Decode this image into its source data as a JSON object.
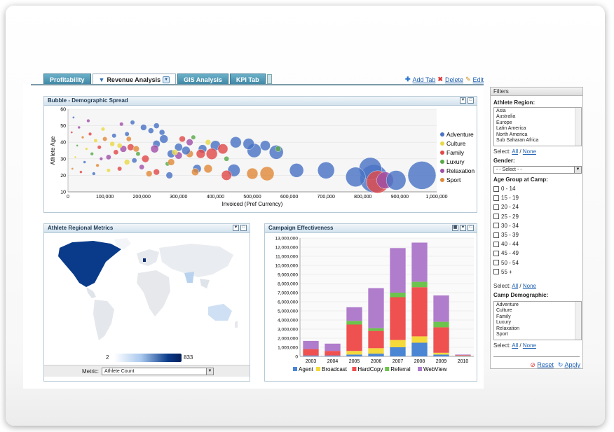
{
  "tabs": [
    {
      "label": "Profitability",
      "active": false
    },
    {
      "label": "Revenue Analysis",
      "active": true
    },
    {
      "label": "GIS Analysis",
      "active": false
    },
    {
      "label": "KPI Tab",
      "active": false
    }
  ],
  "tab_actions": {
    "add": "Add Tab",
    "delete": "Delete",
    "edit": "Edit"
  },
  "bubble_panel": {
    "title": "Bubble - Demographic Spread"
  },
  "map_panel": {
    "title": "Athlete Regional Metrics",
    "legend_min": "2",
    "legend_max": "833",
    "metric_label": "Metric:",
    "metric_value": "Athlete Count"
  },
  "campaign_panel": {
    "title": "Campaign Effectiveness"
  },
  "filters": {
    "title": "Filters",
    "region_label": "Athlete Region:",
    "regions": [
      "Asia",
      "Australia",
      "Europe",
      "Latin America",
      "North America",
      "Sub Saharan Africa"
    ],
    "select_label": "Select:",
    "all": "All",
    "none": "None",
    "slash": "/",
    "gender_label": "Gender:",
    "gender_value": "- - Select - -",
    "age_label": "Age Group at Camp:",
    "age_groups": [
      "0 - 14",
      "15 - 19",
      "20 - 24",
      "25 - 29",
      "30 - 34",
      "35 - 39",
      "40 - 44",
      "45 - 49",
      "50 - 54",
      "55 +"
    ],
    "camp_label": "Camp Demographic:",
    "camps": [
      "Adventure",
      "Culture",
      "Family",
      "Luxury",
      "Relaxation",
      "Sport"
    ],
    "reset": "Reset",
    "apply": "Apply"
  },
  "colors": {
    "adventure": "#4a74c4",
    "culture": "#e8d84a",
    "family": "#e04a4a",
    "luxury": "#5aa84a",
    "relaxation": "#a050a8",
    "sport": "#e08a3a"
  },
  "chart_data": [
    {
      "type": "scatter",
      "title": "Bubble - Demographic Spread",
      "xlabel": "Invoiced (Pref Currency)",
      "ylabel": "Athlete Age",
      "xlim": [
        0,
        1000000
      ],
      "ylim": [
        10,
        60
      ],
      "x_ticks": [
        "0",
        "100,000",
        "200,000",
        "300,000",
        "400,000",
        "500,000",
        "600,000",
        "700,000",
        "800,000",
        "900,000",
        "1,000,000"
      ],
      "y_ticks": [
        "10",
        "20",
        "30",
        "40",
        "50",
        "60"
      ],
      "legend": [
        "Adventure",
        "Culture",
        "Family",
        "Luxury",
        "Relaxation",
        "Sport"
      ],
      "legend_position": "right",
      "points": [
        {
          "s": "Adventure",
          "x": 960000,
          "y": 20,
          "r": 5
        },
        {
          "s": "Adventure",
          "x": 830000,
          "y": 18,
          "r": 5
        },
        {
          "s": "Adventure",
          "x": 820000,
          "y": 24,
          "r": 4
        },
        {
          "s": "Family",
          "x": 840000,
          "y": 16,
          "r": 4
        },
        {
          "s": "Relaxation",
          "x": 860000,
          "y": 17,
          "r": 3
        },
        {
          "s": "Adventure",
          "x": 780000,
          "y": 19,
          "r": 3.5
        },
        {
          "s": "Adventure",
          "x": 890000,
          "y": 17,
          "r": 3.5
        },
        {
          "s": "Adventure",
          "x": 700000,
          "y": 23,
          "r": 3
        },
        {
          "s": "Adventure",
          "x": 620000,
          "y": 23,
          "r": 2.5
        },
        {
          "s": "Adventure",
          "x": 565000,
          "y": 34,
          "r": 2.5
        },
        {
          "s": "Adventure",
          "x": 505000,
          "y": 35,
          "r": 2.5
        },
        {
          "s": "Sport",
          "x": 540000,
          "y": 21,
          "r": 2.5
        },
        {
          "s": "Sport",
          "x": 500000,
          "y": 21,
          "r": 2
        },
        {
          "s": "Adventure",
          "x": 450000,
          "y": 23,
          "r": 2.2
        },
        {
          "s": "Adventure",
          "x": 455000,
          "y": 40,
          "r": 2
        },
        {
          "s": "Adventure",
          "x": 490000,
          "y": 39,
          "r": 2
        },
        {
          "s": "Adventure",
          "x": 535000,
          "y": 38,
          "r": 1.8
        },
        {
          "s": "Adventure",
          "x": 400000,
          "y": 38,
          "r": 1.8
        },
        {
          "s": "Family",
          "x": 390000,
          "y": 33,
          "r": 2
        },
        {
          "s": "Family",
          "x": 420000,
          "y": 36,
          "r": 1.8
        },
        {
          "s": "Family",
          "x": 430000,
          "y": 20,
          "r": 1.8
        },
        {
          "s": "Sport",
          "x": 380000,
          "y": 24,
          "r": 1.5
        },
        {
          "s": "Adventure",
          "x": 350000,
          "y": 24,
          "r": 1.5
        },
        {
          "s": "Sport",
          "x": 345000,
          "y": 22,
          "r": 1.3
        },
        {
          "s": "Adventure",
          "x": 365000,
          "y": 36,
          "r": 1.5
        },
        {
          "s": "Family",
          "x": 360000,
          "y": 33,
          "r": 1.6
        },
        {
          "s": "Sport",
          "x": 330000,
          "y": 33,
          "r": 1.3
        },
        {
          "s": "Adventure",
          "x": 320000,
          "y": 35,
          "r": 1.5
        },
        {
          "s": "Adventure",
          "x": 300000,
          "y": 37,
          "r": 1.4
        },
        {
          "s": "Adventure",
          "x": 280000,
          "y": 33,
          "r": 1.4
        },
        {
          "s": "Relaxation",
          "x": 300000,
          "y": 32,
          "r": 1.3
        },
        {
          "s": "Adventure",
          "x": 260000,
          "y": 42,
          "r": 1.5
        },
        {
          "s": "Adventure",
          "x": 240000,
          "y": 39,
          "r": 1.3
        },
        {
          "s": "Relaxation",
          "x": 235000,
          "y": 36,
          "r": 1.4
        },
        {
          "s": "Family",
          "x": 210000,
          "y": 30,
          "r": 1.3
        },
        {
          "s": "Adventure",
          "x": 275000,
          "y": 20,
          "r": 1.2
        },
        {
          "s": "Family",
          "x": 240000,
          "y": 22,
          "r": 1.1
        },
        {
          "s": "Sport",
          "x": 220000,
          "y": 21,
          "r": 1.1
        },
        {
          "s": "Adventure",
          "x": 205000,
          "y": 49,
          "r": 1.1
        },
        {
          "s": "Adventure",
          "x": 225000,
          "y": 47,
          "r": 1.0
        },
        {
          "s": "Adventure",
          "x": 240000,
          "y": 50,
          "r": 1.0
        },
        {
          "s": "Adventure",
          "x": 255000,
          "y": 46,
          "r": 1.0
        },
        {
          "s": "Relaxation",
          "x": 150000,
          "y": 36,
          "r": 1.2
        },
        {
          "s": "Family",
          "x": 170000,
          "y": 37,
          "r": 1.2
        },
        {
          "s": "Sport",
          "x": 185000,
          "y": 36,
          "r": 1.1
        },
        {
          "s": "Culture",
          "x": 160000,
          "y": 28,
          "r": 1.0
        },
        {
          "s": "Adventure",
          "x": 180000,
          "y": 29,
          "r": 0.9
        },
        {
          "s": "Family",
          "x": 130000,
          "y": 34,
          "r": 0.9
        },
        {
          "s": "Culture",
          "x": 120000,
          "y": 39,
          "r": 0.9
        },
        {
          "s": "Relaxation",
          "x": 110000,
          "y": 31,
          "r": 0.9
        },
        {
          "s": "Sport",
          "x": 100000,
          "y": 42,
          "r": 0.8
        },
        {
          "s": "Family",
          "x": 140000,
          "y": 24,
          "r": 0.8
        },
        {
          "s": "Adventure",
          "x": 160000,
          "y": 45,
          "r": 0.8
        },
        {
          "s": "Adventure",
          "x": 175000,
          "y": 52,
          "r": 0.8
        },
        {
          "s": "Relaxation",
          "x": 145000,
          "y": 51,
          "r": 0.7
        },
        {
          "s": "Culture",
          "x": 95000,
          "y": 48,
          "r": 0.7
        },
        {
          "s": "Family",
          "x": 85000,
          "y": 37,
          "r": 0.7
        },
        {
          "s": "Culture",
          "x": 75000,
          "y": 41,
          "r": 0.7
        },
        {
          "s": "Relaxation",
          "x": 90000,
          "y": 30,
          "r": 0.6
        },
        {
          "s": "Sport",
          "x": 80000,
          "y": 26,
          "r": 0.6
        },
        {
          "s": "Adventure",
          "x": 70000,
          "y": 21,
          "r": 0.6
        },
        {
          "s": "Luxury",
          "x": 65000,
          "y": 33,
          "r": 0.6
        },
        {
          "s": "Family",
          "x": 60000,
          "y": 45,
          "r": 0.6
        },
        {
          "s": "Relaxation",
          "x": 55000,
          "y": 53,
          "r": 0.6
        },
        {
          "s": "Culture",
          "x": 50000,
          "y": 36,
          "r": 0.5
        },
        {
          "s": "Adventure",
          "x": 45000,
          "y": 28,
          "r": 0.5
        },
        {
          "s": "Sport",
          "x": 40000,
          "y": 43,
          "r": 0.5
        },
        {
          "s": "Family",
          "x": 35000,
          "y": 22,
          "r": 0.5
        },
        {
          "s": "Relaxation",
          "x": 30000,
          "y": 49,
          "r": 0.5
        },
        {
          "s": "Luxury",
          "x": 25000,
          "y": 38,
          "r": 0.4
        },
        {
          "s": "Culture",
          "x": 20000,
          "y": 31,
          "r": 0.4
        },
        {
          "s": "Adventure",
          "x": 15000,
          "y": 55,
          "r": 0.4
        },
        {
          "s": "Sport",
          "x": 12000,
          "y": 24,
          "r": 0.4
        },
        {
          "s": "Family",
          "x": 10000,
          "y": 46,
          "r": 0.4
        },
        {
          "s": "Luxury",
          "x": 340000,
          "y": 43,
          "r": 0.8
        },
        {
          "s": "Luxury",
          "x": 270000,
          "y": 27,
          "r": 0.8
        },
        {
          "s": "Luxury",
          "x": 190000,
          "y": 33,
          "r": 0.8
        },
        {
          "s": "Luxury",
          "x": 430000,
          "y": 30,
          "r": 0.9
        },
        {
          "s": "Luxury",
          "x": 570000,
          "y": 36,
          "r": 1.0
        },
        {
          "s": "Culture",
          "x": 290000,
          "y": 34,
          "r": 1.0
        },
        {
          "s": "Culture",
          "x": 380000,
          "y": 40,
          "r": 1.0
        },
        {
          "s": "Relaxation",
          "x": 330000,
          "y": 40,
          "r": 1.2
        },
        {
          "s": "Sport",
          "x": 280000,
          "y": 28,
          "r": 1.2
        },
        {
          "s": "Culture",
          "x": 110000,
          "y": 23,
          "r": 0.7
        },
        {
          "s": "Relaxation",
          "x": 200000,
          "y": 25,
          "r": 0.9
        },
        {
          "s": "Family",
          "x": 310000,
          "y": 42,
          "r": 1.1
        },
        {
          "s": "Adventure",
          "x": 125000,
          "y": 44,
          "r": 0.8
        },
        {
          "s": "Sport",
          "x": 165000,
          "y": 42,
          "r": 0.9
        },
        {
          "s": "Culture",
          "x": 140000,
          "y": 38,
          "r": 0.9
        }
      ]
    },
    {
      "type": "bar",
      "title": "Campaign Effectiveness",
      "stacked": true,
      "categories": [
        "2003",
        "2004",
        "2005",
        "2006",
        "2007",
        "2008",
        "2009",
        "2010"
      ],
      "ylim": [
        0,
        13000000
      ],
      "y_ticks": [
        "0",
        "1,000,000",
        "2,000,000",
        "3,000,000",
        "4,000,000",
        "5,000,000",
        "6,000,000",
        "7,000,000",
        "8,000,000",
        "9,000,000",
        "10,000,000",
        "11,000,000",
        "12,000,000",
        "13,000,000"
      ],
      "legend_position": "bottom",
      "series": [
        {
          "name": "Agent",
          "color": "#4a86d4",
          "values": [
            100000,
            100000,
            200000,
            300000,
            1000000,
            1500000,
            200000,
            50000
          ]
        },
        {
          "name": "Broadcast",
          "color": "#f4d93a",
          "values": [
            0,
            0,
            400000,
            600000,
            800000,
            700000,
            200000,
            30000
          ]
        },
        {
          "name": "HardCopy",
          "color": "#ef5050",
          "values": [
            700000,
            500000,
            2900000,
            1900000,
            4700000,
            5400000,
            2800000,
            60000
          ]
        },
        {
          "name": "Referral",
          "color": "#6cc44c",
          "values": [
            0,
            0,
            400000,
            300000,
            500000,
            600000,
            600000,
            0
          ]
        },
        {
          "name": "WebView",
          "color": "#b07ccc",
          "values": [
            900000,
            800000,
            1500000,
            4400000,
            4900000,
            4300000,
            2900000,
            60000
          ]
        }
      ]
    }
  ]
}
